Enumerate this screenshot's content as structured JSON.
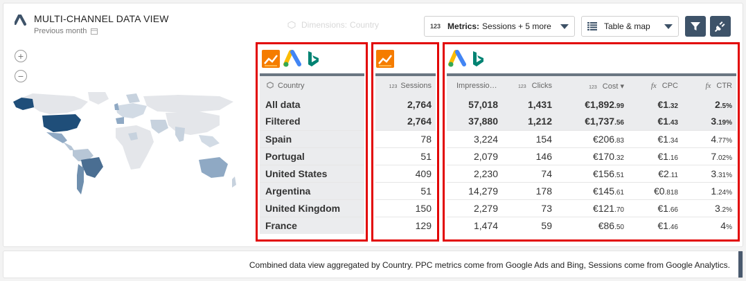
{
  "header": {
    "title": "MULTI-CHANNEL DATA VIEW",
    "subtitle": "Previous month"
  },
  "controls": {
    "dimensions_label": "Dimensions:",
    "dimensions_value": "Country",
    "metrics_prefix": "123",
    "metrics_label": "Metrics:",
    "metrics_value": "Sessions + 5 more",
    "view_label": "Table & map",
    "filter_icon": "filter-icon",
    "plugin_icon": "plug-icon"
  },
  "map": {
    "zoom_in": "+",
    "zoom_out": "−"
  },
  "table": {
    "headers": {
      "country": "Country",
      "sessions_prefix": "123",
      "sessions": "Sessions",
      "impressions": "Impressio…",
      "clicks_prefix": "123",
      "clicks": "Clicks",
      "cost_prefix": "123",
      "cost": "Cost ▾",
      "cpc_prefix": "fx",
      "cpc": "CPC",
      "ctr_prefix": "fx",
      "ctr": "CTR"
    },
    "rows": [
      {
        "country": "All data",
        "sessions": "2,764",
        "impressions": "57,018",
        "clicks": "1,431",
        "cost_main": "€1,892",
        "cost_dec": ".99",
        "cpc_main": "€1",
        "cpc_dec": ".32",
        "ctr_main": "2",
        "ctr_dec": ".5%"
      },
      {
        "country": "Filtered",
        "sessions": "2,764",
        "impressions": "37,880",
        "clicks": "1,212",
        "cost_main": "€1,737",
        "cost_dec": ".56",
        "cpc_main": "€1",
        "cpc_dec": ".43",
        "ctr_main": "3",
        "ctr_dec": ".19%"
      },
      {
        "country": "Spain",
        "sessions": "78",
        "impressions": "3,224",
        "clicks": "154",
        "cost_main": "€206",
        "cost_dec": ".83",
        "cpc_main": "€1",
        "cpc_dec": ".34",
        "ctr_main": "4",
        "ctr_dec": ".77%"
      },
      {
        "country": "Portugal",
        "sessions": "51",
        "impressions": "2,079",
        "clicks": "146",
        "cost_main": "€170",
        "cost_dec": ".32",
        "cpc_main": "€1",
        "cpc_dec": ".16",
        "ctr_main": "7",
        "ctr_dec": ".02%"
      },
      {
        "country": "United States",
        "sessions": "409",
        "impressions": "2,230",
        "clicks": "74",
        "cost_main": "€156",
        "cost_dec": ".51",
        "cpc_main": "€2",
        "cpc_dec": ".11",
        "ctr_main": "3",
        "ctr_dec": ".31%"
      },
      {
        "country": "Argentina",
        "sessions": "51",
        "impressions": "14,279",
        "clicks": "178",
        "cost_main": "€145",
        "cost_dec": ".61",
        "cpc_main": "€0",
        "cpc_dec": ".818",
        "ctr_main": "1",
        "ctr_dec": ".24%"
      },
      {
        "country": "United Kingdom",
        "sessions": "150",
        "impressions": "2,279",
        "clicks": "73",
        "cost_main": "€121",
        "cost_dec": ".70",
        "cpc_main": "€1",
        "cpc_dec": ".66",
        "ctr_main": "3",
        "ctr_dec": ".2%"
      },
      {
        "country": "France",
        "sessions": "129",
        "impressions": "1,474",
        "clicks": "59",
        "cost_main": "€86",
        "cost_dec": ".50",
        "cpc_main": "€1",
        "cpc_dec": ".46",
        "ctr_main": "4",
        "ctr_dec": "%"
      }
    ]
  },
  "caption": "Combined data view aggregated by Country. PPC metrics come from Google Ads and Bing, Sessions come from Google Analytics.",
  "colors": {
    "highlight": "#e20000",
    "accent": "#3e5369",
    "map_dark": "#1f4e79",
    "map_mid": "#8fa9c4",
    "map_light": "#e4e6ea"
  }
}
